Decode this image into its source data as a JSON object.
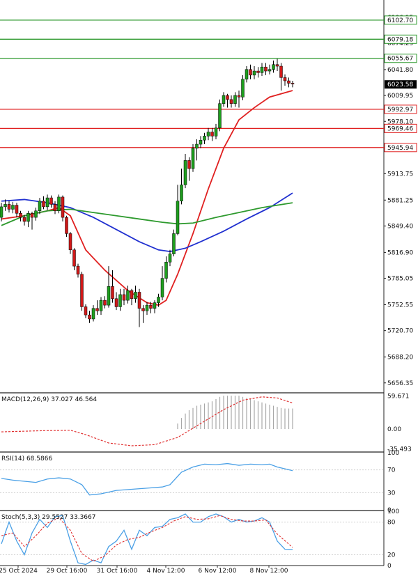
{
  "chart_data": [
    {
      "type": "candlestick",
      "panel": "price",
      "y_ticks": [
        6106.15,
        6074.25,
        6041.8,
        6009.95,
        5978.1,
        5945.94,
        5913.75,
        5881.25,
        5849.4,
        5816.9,
        5785.05,
        5752.55,
        5720.7,
        5688.2,
        5656.35
      ],
      "ylim": [
        5645,
        6112
      ],
      "last_price": 6023.58,
      "levels": [
        {
          "value": 6102.7,
          "label": "6102.70",
          "color": "#2e9a2e"
        },
        {
          "value": 6079.18,
          "label": "6079.18",
          "color": "#2e9a2e"
        },
        {
          "value": 6055.67,
          "label": "6055.67",
          "color": "#2e9a2e"
        },
        {
          "value": 5992.97,
          "label": "5992.97",
          "color": "#e02020"
        },
        {
          "value": 5969.46,
          "label": "5969.46",
          "color": "#e02020"
        },
        {
          "value": 5945.94,
          "label": "5945.94",
          "color": "#e02020"
        }
      ],
      "x_labels": [
        "25 Oct 2024",
        "29 Oct 16:00",
        "31 Oct 16:00",
        "4 Nov 12:00",
        "6 Nov 12:00",
        "8 Nov 12:00"
      ],
      "candles": [
        [
          5860,
          5873,
          5855,
          5878
        ],
        [
          5873,
          5876,
          5868,
          5882
        ],
        [
          5876,
          5870,
          5866,
          5880
        ],
        [
          5870,
          5875,
          5865,
          5879
        ],
        [
          5875,
          5865,
          5860,
          5878
        ],
        [
          5865,
          5860,
          5855,
          5868
        ],
        [
          5860,
          5855,
          5850,
          5863
        ],
        [
          5855,
          5865,
          5848,
          5868
        ],
        [
          5865,
          5860,
          5845,
          5867
        ],
        [
          5860,
          5868,
          5856,
          5872
        ],
        [
          5868,
          5880,
          5864,
          5884
        ],
        [
          5880,
          5873,
          5870,
          5886
        ],
        [
          5873,
          5884,
          5869,
          5888
        ],
        [
          5884,
          5876,
          5872,
          5887
        ],
        [
          5876,
          5868,
          5864,
          5880
        ],
        [
          5868,
          5885,
          5865,
          5888
        ],
        [
          5885,
          5860,
          5855,
          5887
        ],
        [
          5860,
          5840,
          5836,
          5862
        ],
        [
          5840,
          5820,
          5815,
          5842
        ],
        [
          5820,
          5800,
          5795,
          5822
        ],
        [
          5800,
          5790,
          5786,
          5803
        ],
        [
          5790,
          5750,
          5745,
          5793
        ],
        [
          5750,
          5740,
          5736,
          5753
        ],
        [
          5740,
          5735,
          5730,
          5745
        ],
        [
          5735,
          5748,
          5732,
          5752
        ],
        [
          5748,
          5745,
          5740,
          5758
        ],
        [
          5745,
          5758,
          5740,
          5762
        ],
        [
          5758,
          5752,
          5748,
          5763
        ],
        [
          5752,
          5775,
          5749,
          5800
        ],
        [
          5775,
          5760,
          5755,
          5795
        ],
        [
          5760,
          5750,
          5746,
          5768
        ],
        [
          5750,
          5765,
          5745,
          5772
        ],
        [
          5765,
          5758,
          5752,
          5772
        ],
        [
          5758,
          5770,
          5754,
          5776
        ],
        [
          5770,
          5760,
          5752,
          5772
        ],
        [
          5760,
          5768,
          5755,
          5776
        ],
        [
          5768,
          5748,
          5725,
          5772
        ],
        [
          5748,
          5745,
          5730,
          5752
        ],
        [
          5745,
          5752,
          5740,
          5756
        ],
        [
          5752,
          5748,
          5742,
          5756
        ],
        [
          5748,
          5755,
          5742,
          5758
        ],
        [
          5755,
          5762,
          5750,
          5766
        ],
        [
          5762,
          5785,
          5758,
          5800
        ],
        [
          5785,
          5805,
          5780,
          5812
        ],
        [
          5805,
          5815,
          5800,
          5820
        ],
        [
          5815,
          5840,
          5812,
          5845
        ],
        [
          5840,
          5880,
          5838,
          5900
        ],
        [
          5880,
          5900,
          5876,
          5920
        ],
        [
          5900,
          5930,
          5896,
          5938
        ],
        [
          5930,
          5920,
          5905,
          5934
        ],
        [
          5920,
          5945,
          5916,
          5950
        ],
        [
          5945,
          5950,
          5930,
          5956
        ],
        [
          5950,
          5955,
          5945,
          5960
        ],
        [
          5955,
          5960,
          5950,
          5964
        ],
        [
          5960,
          5965,
          5955,
          5970
        ],
        [
          5965,
          5960,
          5954,
          5970
        ],
        [
          5960,
          5970,
          5956,
          5975
        ],
        [
          5970,
          6000,
          5966,
          6005
        ],
        [
          6000,
          6010,
          5996,
          6014
        ],
        [
          6010,
          6005,
          5995,
          6012
        ],
        [
          6005,
          6000,
          5995,
          6010
        ],
        [
          6000,
          6010,
          5996,
          6014
        ],
        [
          6010,
          6008,
          5995,
          6016
        ],
        [
          6008,
          6030,
          6004,
          6035
        ],
        [
          6030,
          6042,
          6026,
          6046
        ],
        [
          6042,
          6035,
          6030,
          6048
        ],
        [
          6035,
          6040,
          6030,
          6046
        ],
        [
          6040,
          6038,
          6032,
          6045
        ],
        [
          6038,
          6045,
          6034,
          6050
        ],
        [
          6045,
          6040,
          6035,
          6050
        ],
        [
          6040,
          6042,
          6036,
          6048
        ],
        [
          6042,
          6048,
          6038,
          6053
        ],
        [
          6048,
          6046,
          6040,
          6055
        ],
        [
          6046,
          6032,
          6016,
          6050
        ],
        [
          6032,
          6028,
          6022,
          6036
        ],
        [
          6028,
          6025,
          6020,
          6032
        ],
        [
          6025,
          6024,
          6020,
          6028
        ]
      ],
      "series": [
        {
          "color": "#e02020",
          "points": [
            [
              0,
              5858
            ],
            [
              6,
              5862
            ],
            [
              12,
              5868
            ],
            [
              15,
              5872
            ],
            [
              18,
              5862
            ],
            [
              22,
              5820
            ],
            [
              27,
              5795
            ],
            [
              33,
              5770
            ],
            [
              38,
              5755
            ],
            [
              41,
              5752
            ],
            [
              43,
              5758
            ],
            [
              46,
              5790
            ],
            [
              50,
              5840
            ],
            [
              54,
              5895
            ],
            [
              58,
              5945
            ],
            [
              62,
              5980
            ],
            [
              66,
              5995
            ],
            [
              70,
              6008
            ],
            [
              76,
              6016
            ]
          ]
        },
        {
          "color": "#2030d0",
          "points": [
            [
              0,
              5880
            ],
            [
              6,
              5882
            ],
            [
              12,
              5878
            ],
            [
              18,
              5872
            ],
            [
              24,
              5860
            ],
            [
              30,
              5845
            ],
            [
              36,
              5830
            ],
            [
              41,
              5820
            ],
            [
              44,
              5818
            ],
            [
              48,
              5822
            ],
            [
              52,
              5830
            ],
            [
              58,
              5843
            ],
            [
              64,
              5858
            ],
            [
              70,
              5872
            ],
            [
              76,
              5890
            ]
          ]
        },
        {
          "color": "#2e9a2e",
          "points": [
            [
              0,
              5850
            ],
            [
              6,
              5862
            ],
            [
              12,
              5868
            ],
            [
              18,
              5870
            ],
            [
              24,
              5866
            ],
            [
              30,
              5862
            ],
            [
              36,
              5858
            ],
            [
              42,
              5854
            ],
            [
              46,
              5852
            ],
            [
              50,
              5853
            ],
            [
              56,
              5860
            ],
            [
              62,
              5866
            ],
            [
              68,
              5872
            ],
            [
              76,
              5878
            ]
          ]
        }
      ]
    },
    {
      "type": "macd",
      "panel": "macd",
      "title": "MACD(12,26,9) 37.027 46.564",
      "y_ticks": [
        59.671,
        0.0,
        -35.493
      ],
      "ylim": [
        -40,
        64
      ],
      "histogram": [
        0,
        0,
        0,
        0,
        0,
        0,
        0,
        0,
        0,
        0,
        0,
        0,
        0,
        0,
        0,
        0,
        0,
        0,
        0,
        0,
        0,
        0,
        0,
        0,
        0,
        0,
        0,
        0,
        0,
        0,
        0,
        0,
        0,
        0,
        0,
        0,
        0,
        0,
        0,
        0,
        0,
        0,
        0,
        0,
        0,
        0,
        10,
        20,
        28,
        34,
        38,
        42,
        44,
        46,
        48,
        50,
        54,
        58,
        60,
        60,
        60,
        60,
        60,
        58,
        56,
        54,
        52,
        50,
        48,
        46,
        44,
        42,
        40,
        38,
        37,
        37,
        37
      ],
      "signal": [
        [
          0,
          -5
        ],
        [
          10,
          -3
        ],
        [
          18,
          -2
        ],
        [
          22,
          -10
        ],
        [
          28,
          -25
        ],
        [
          34,
          -30
        ],
        [
          40,
          -28
        ],
        [
          46,
          -15
        ],
        [
          52,
          10
        ],
        [
          58,
          35
        ],
        [
          63,
          52
        ],
        [
          68,
          58
        ],
        [
          72,
          56
        ],
        [
          76,
          47
        ]
      ]
    },
    {
      "type": "line",
      "panel": "rsi",
      "title": "RSI(14) 68.5866",
      "y_ticks": [
        100,
        70,
        30,
        0
      ],
      "ylim": [
        0,
        100
      ],
      "values": [
        [
          0,
          55
        ],
        [
          3,
          52
        ],
        [
          6,
          50
        ],
        [
          9,
          48
        ],
        [
          12,
          54
        ],
        [
          15,
          56
        ],
        [
          18,
          54
        ],
        [
          21,
          44
        ],
        [
          23,
          26
        ],
        [
          26,
          28
        ],
        [
          30,
          34
        ],
        [
          34,
          36
        ],
        [
          38,
          38
        ],
        [
          42,
          40
        ],
        [
          44,
          44
        ],
        [
          47,
          66
        ],
        [
          50,
          75
        ],
        [
          53,
          80
        ],
        [
          56,
          79
        ],
        [
          59,
          81
        ],
        [
          62,
          78
        ],
        [
          65,
          80
        ],
        [
          68,
          79
        ],
        [
          70,
          80
        ],
        [
          72,
          75
        ],
        [
          76,
          68.6
        ]
      ]
    },
    {
      "type": "line",
      "panel": "stoch",
      "title": "Stoch(5,3,3) 29.5527 33.3667",
      "y_ticks": [
        100,
        80,
        20,
        0
      ],
      "ylim": [
        0,
        100
      ],
      "k": [
        [
          0,
          40
        ],
        [
          2,
          80
        ],
        [
          4,
          45
        ],
        [
          6,
          20
        ],
        [
          8,
          60
        ],
        [
          10,
          85
        ],
        [
          12,
          70
        ],
        [
          14,
          90
        ],
        [
          16,
          92
        ],
        [
          18,
          45
        ],
        [
          20,
          5
        ],
        [
          22,
          2
        ],
        [
          24,
          10
        ],
        [
          26,
          5
        ],
        [
          28,
          35
        ],
        [
          30,
          45
        ],
        [
          32,
          65
        ],
        [
          34,
          30
        ],
        [
          36,
          65
        ],
        [
          38,
          55
        ],
        [
          40,
          70
        ],
        [
          42,
          72
        ],
        [
          44,
          85
        ],
        [
          46,
          88
        ],
        [
          48,
          95
        ],
        [
          50,
          80
        ],
        [
          52,
          80
        ],
        [
          54,
          90
        ],
        [
          56,
          95
        ],
        [
          58,
          90
        ],
        [
          60,
          80
        ],
        [
          62,
          85
        ],
        [
          64,
          80
        ],
        [
          66,
          82
        ],
        [
          68,
          88
        ],
        [
          70,
          80
        ],
        [
          72,
          45
        ],
        [
          74,
          30
        ],
        [
          76,
          29.6
        ]
      ],
      "d": [
        [
          0,
          55
        ],
        [
          3,
          60
        ],
        [
          6,
          35
        ],
        [
          9,
          55
        ],
        [
          12,
          78
        ],
        [
          15,
          88
        ],
        [
          18,
          65
        ],
        [
          21,
          22
        ],
        [
          24,
          8
        ],
        [
          27,
          18
        ],
        [
          30,
          38
        ],
        [
          33,
          48
        ],
        [
          36,
          52
        ],
        [
          39,
          62
        ],
        [
          42,
          70
        ],
        [
          45,
          82
        ],
        [
          48,
          90
        ],
        [
          51,
          85
        ],
        [
          54,
          86
        ],
        [
          57,
          92
        ],
        [
          60,
          85
        ],
        [
          63,
          82
        ],
        [
          66,
          82
        ],
        [
          69,
          84
        ],
        [
          72,
          58
        ],
        [
          76,
          33.4
        ]
      ]
    }
  ]
}
